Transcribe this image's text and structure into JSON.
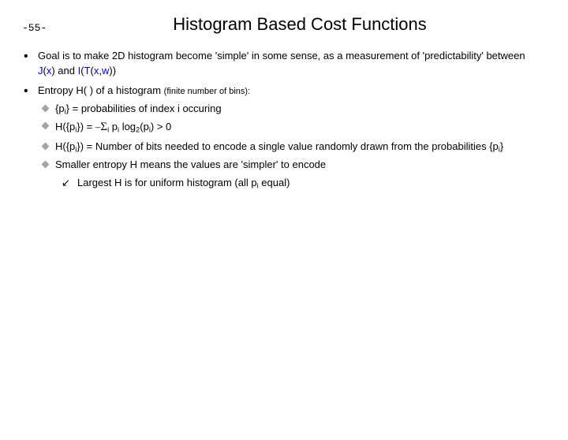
{
  "page_number": "-55-",
  "title": "Histogram Based Cost Functions",
  "bullets": [
    {
      "pre": "Goal is to make 2D histogram become 'simple' in some sense, as a measurement of 'predictability' between ",
      "fJ": "J",
      "arg1a": "(",
      "xb1": "x",
      "arg1b": ") and ",
      "fI": "I",
      "arg2a": "(",
      "Tb": "T",
      "arg2b": "(",
      "xb2": "x",
      "comma": ",",
      "wb": "w",
      "close": "))"
    },
    {
      "pre": "Entropy H( ) of a histogram ",
      "finite": "(finite number of bins):"
    }
  ],
  "sub": {
    "s1": {
      "a": "{p",
      "b": "} = probabilities of index i occuring"
    },
    "s2": {
      "a": "H({p",
      "b": "}) = ",
      "sig_pre": "",
      "c": " p",
      "d": " log",
      "e": "(p",
      "f": ")  >  0"
    },
    "s3": {
      "a": "H({p",
      "b": "}) = Number of bits needed to encode a single value randomly drawn from the probabilities {p",
      "c": "}"
    },
    "s4": "Smaller entropy H means the values are 'simpler' to encode"
  },
  "subsub": {
    "a": "Largest H is for uniform histogram (all p",
    "b": " equal)"
  },
  "i": "i",
  "two": "2",
  "minus": "–"
}
